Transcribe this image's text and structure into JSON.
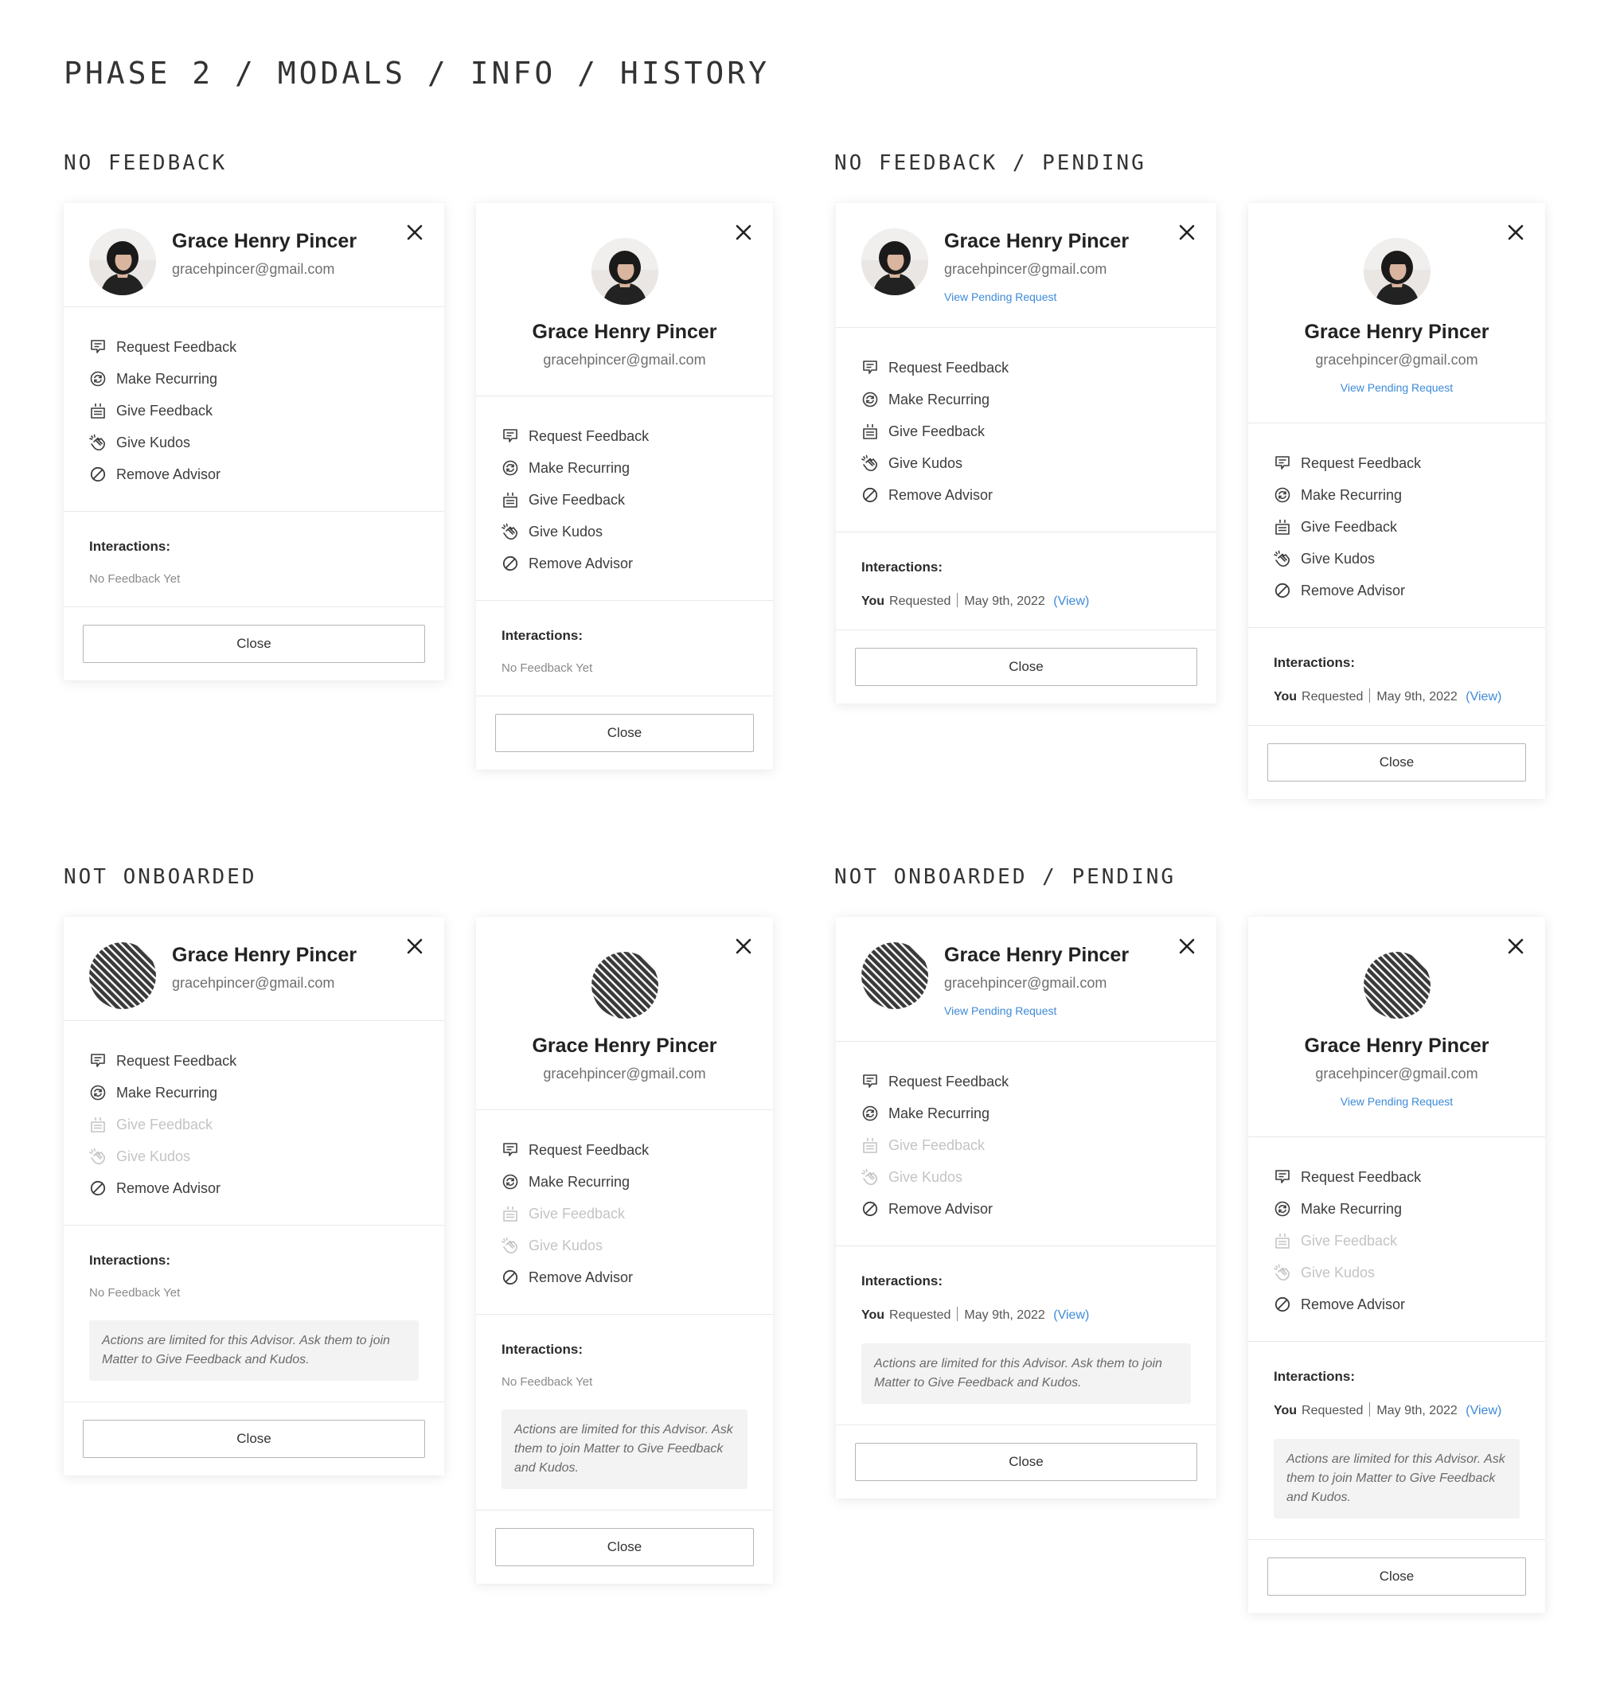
{
  "page_title": "PHASE 2 / MODALS / INFO / HISTORY",
  "sections": [
    {
      "title": "NO FEEDBACK"
    },
    {
      "title": "NO FEEDBACK / PENDING"
    },
    {
      "title": "NOT ONBOARDED"
    },
    {
      "title": "NOT ONBOARDED / PENDING"
    }
  ],
  "user": {
    "name": "Grace Henry Pincer",
    "email": "gracehpincer@gmail.com"
  },
  "pending_link": "View Pending Request",
  "actions": {
    "request_feedback": "Request Feedback",
    "make_recurring": "Make Recurring",
    "give_feedback": "Give Feedback",
    "give_kudos": "Give Kudos",
    "remove_advisor": "Remove Advisor"
  },
  "icons": {
    "request_feedback": "request-feedback-icon",
    "make_recurring": "recurring-icon",
    "give_feedback": "give-feedback-icon",
    "give_kudos": "clap-icon",
    "remove_advisor": "remove-circle-icon",
    "close": "close-icon"
  },
  "interactions": {
    "label": "Interactions:",
    "no_feedback": "No Feedback Yet",
    "who": "You",
    "action": "Requested",
    "date": "May 9th, 2022",
    "view_open": "(",
    "view": "View",
    "view_close": ")"
  },
  "limited_note": "Actions are limited for this Advisor. Ask them to join Matter to Give Feedback and Kudos.",
  "close_label": "Close",
  "colors": {
    "link": "#3d8ad8",
    "disabled": "#c4c4c4",
    "note_bg": "#f3f3f3"
  }
}
